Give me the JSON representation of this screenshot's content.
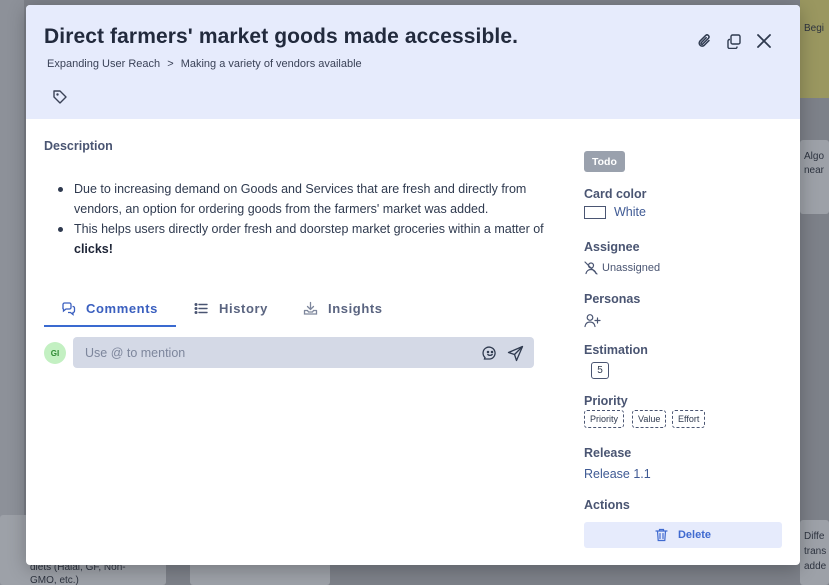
{
  "modal": {
    "title": "Direct farmers' market goods made accessible.",
    "breadcrumb": {
      "parent": "Expanding User Reach",
      "separator": ">",
      "current": "Making a variety of vendors available"
    }
  },
  "description": {
    "label": "Description",
    "bullet_1": "Due to increasing demand on Goods and Services that are fresh and directly from vendors, an option for ordering goods from the farmers' market was added.",
    "bullet_2_text": "This helps users directly order fresh and doorstep market groceries within a matter of ",
    "bullet_2_bold": "clicks!"
  },
  "tabs": {
    "comments": "Comments",
    "history": "History",
    "insights": "Insights"
  },
  "comment": {
    "avatar_initials": "GI",
    "placeholder": "Use @ to mention"
  },
  "sidebar": {
    "status": "Todo",
    "card_color_label": "Card color",
    "card_color_value": "White",
    "assignee_label": "Assignee",
    "assignee_value": "Unassigned",
    "personas_label": "Personas",
    "estimation_label": "Estimation",
    "estimation_value": "5",
    "priority_label": "Priority",
    "priority_chips": [
      "Priority",
      "Value",
      "Effort"
    ],
    "release_label": "Release",
    "release_value": "Release 1.1",
    "actions_label": "Actions",
    "delete_label": "Delete"
  },
  "background": {
    "text_top_right": "Begi",
    "text_right_1a": "Algo",
    "text_right_1b": "near",
    "text_bottom_left_a": "diets (Halal, GF, Non-",
    "text_bottom_left_b": "GMO, etc.)",
    "text_bottom_right_a": "Diffe",
    "text_bottom_right_b": "trans",
    "text_bottom_right_c": "adde"
  },
  "colors": {
    "header_bg": "#e6ebfc",
    "accent": "#3a6ad0",
    "status_bg": "#9aa1ad",
    "avatar_bg": "#c3f0c2"
  }
}
